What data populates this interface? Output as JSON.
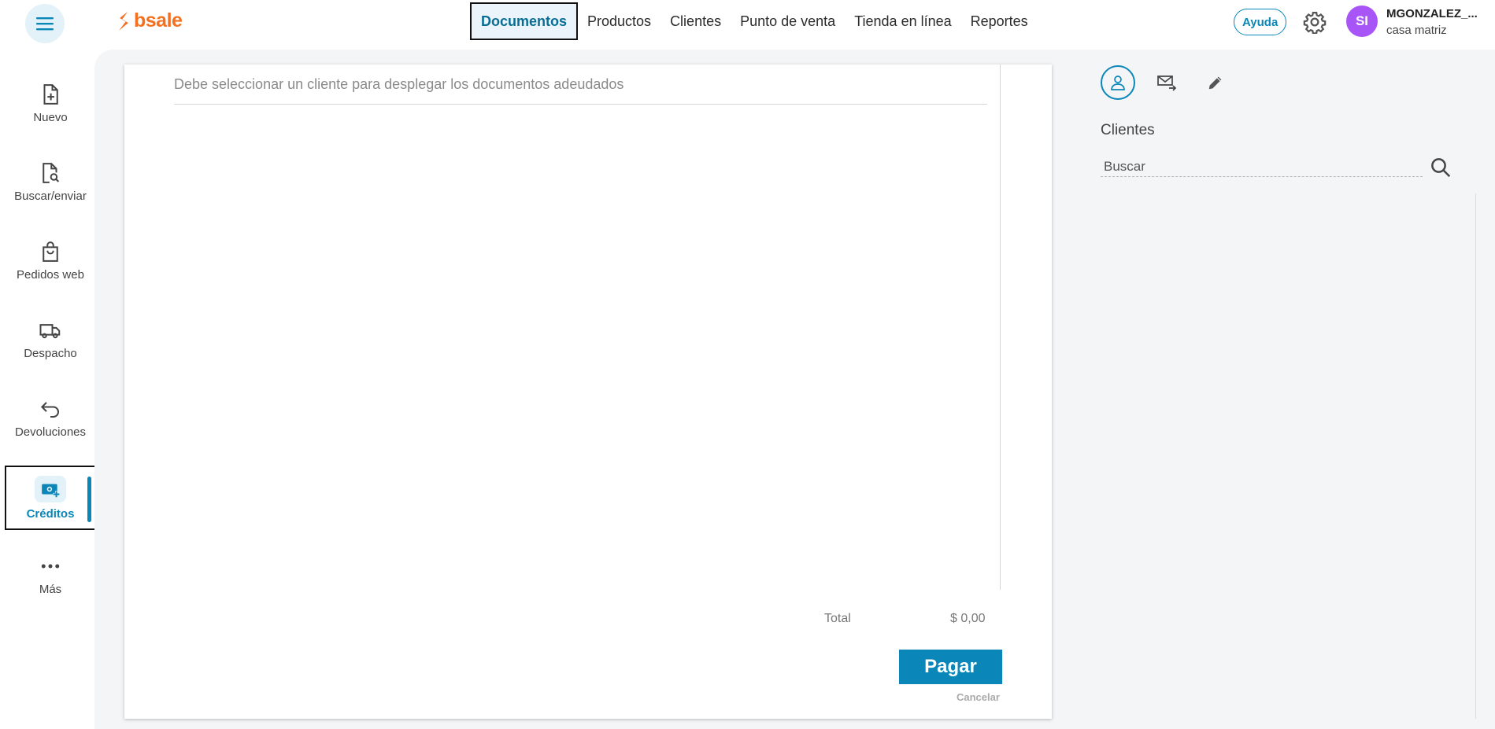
{
  "header": {
    "brand": "bsale",
    "nav": [
      "Documentos",
      "Productos",
      "Clientes",
      "Punto de venta",
      "Tienda en línea",
      "Reportes"
    ],
    "active_nav": "Documentos",
    "help_label": "Ayuda",
    "user_initials": "SI",
    "user_name": "MGONZALEZ_...",
    "user_branch": "casa matriz"
  },
  "sidebar": {
    "items": [
      {
        "label": "Nuevo",
        "icon": "file-plus-icon"
      },
      {
        "label": "Buscar/enviar",
        "icon": "file-search-icon"
      },
      {
        "label": "Pedidos web",
        "icon": "shopping-bag-icon"
      },
      {
        "label": "Despacho",
        "icon": "truck-icon"
      },
      {
        "label": "Devoluciones",
        "icon": "return-arrow-icon"
      },
      {
        "label": "Créditos",
        "icon": "cash-plus-icon",
        "active": true
      },
      {
        "label": "Más",
        "icon": "more-dots-icon"
      }
    ]
  },
  "main": {
    "note": "Debe seleccionar un cliente para desplegar los documentos adeudados",
    "total_label": "Total",
    "total_value": "$ 0,00",
    "pay_label": "Pagar",
    "cancel_label": "Cancelar"
  },
  "right_panel": {
    "title": "Clientes",
    "search_placeholder": "Buscar",
    "search_value": ""
  },
  "colors": {
    "accent": "#0a87b8",
    "brand": "#f37021",
    "avatar": "#a855f7"
  }
}
